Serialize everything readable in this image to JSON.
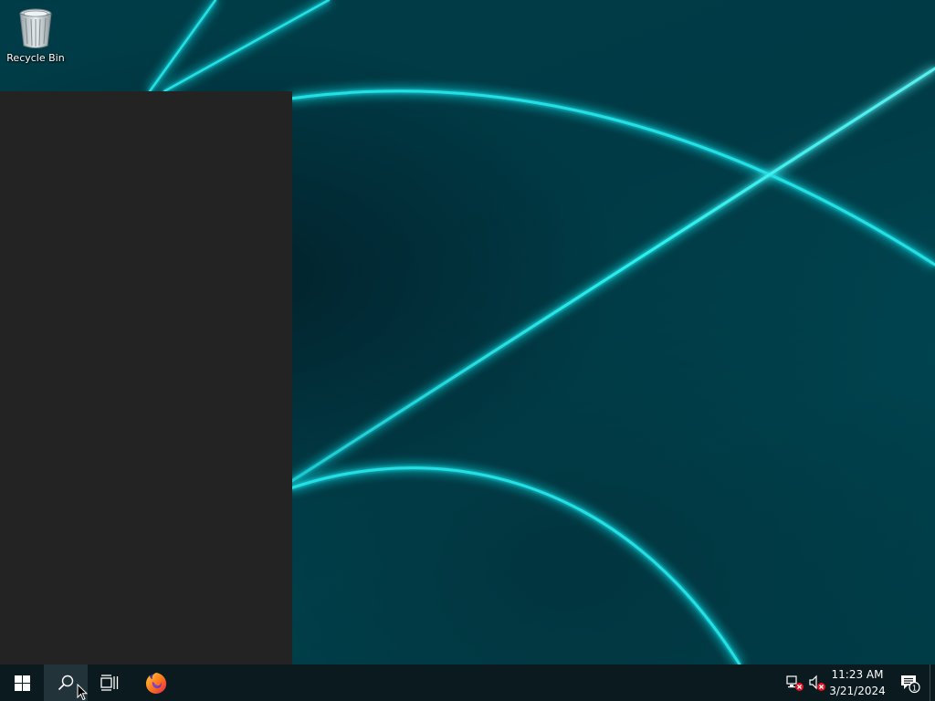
{
  "desktop": {
    "icons": [
      {
        "label": "Recycle Bin",
        "icon": "recycle-bin-icon"
      }
    ]
  },
  "start_menu": {
    "state": "open-empty",
    "background": "#232323"
  },
  "taskbar": {
    "background": "#0b1a1f",
    "start_icon": "windows-logo-icon",
    "search_icon": "search-icon",
    "task_view_icon": "task-view-icon",
    "pinned": [
      {
        "app": "Firefox",
        "icon": "firefox-icon"
      }
    ],
    "tray": {
      "network_icon": "network-disconnected-icon",
      "volume_icon": "volume-muted-icon",
      "clock": {
        "time": "11:23 AM",
        "date": "3/21/2024"
      },
      "notifications": {
        "icon": "action-center-icon",
        "count": "1"
      }
    }
  },
  "colors": {
    "wallpaper_base": "#003c47",
    "wallpaper_glow": "#19e6e6",
    "taskbar": "#0b1a1f",
    "accent_white": "#ffffff"
  }
}
